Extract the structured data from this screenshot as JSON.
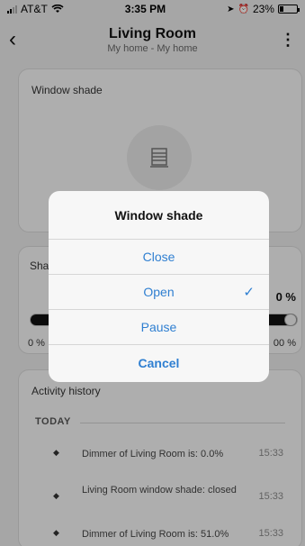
{
  "status_bar": {
    "carrier": "AT&T",
    "time": "3:35 PM",
    "battery": "23%",
    "battery_level": 0.23
  },
  "header": {
    "title": "Living Room",
    "subtitle": "My home - My home"
  },
  "window_card": {
    "title": "Window shade"
  },
  "shade_card": {
    "title_visible": "Sha",
    "value_partial": "0 %",
    "min_label": "0 %",
    "max_label": "00 %",
    "slider_level": 1.0
  },
  "activity": {
    "title": "Activity history",
    "section": "TODAY",
    "items": [
      {
        "text": "Dimmer of Living Room is: 0.0%",
        "time": "15:33"
      },
      {
        "text": "Living Room window shade: closed",
        "time": "15:33"
      },
      {
        "text": "Dimmer of Living Room is: 51.0%",
        "time": "15:33"
      }
    ]
  },
  "dialog": {
    "title": "Window shade",
    "options": [
      {
        "label": "Close",
        "selected": false
      },
      {
        "label": "Open",
        "selected": true
      },
      {
        "label": "Pause",
        "selected": false
      }
    ],
    "cancel_label": "Cancel",
    "accent": "#2f7fd1"
  },
  "icons": [
    "back-icon",
    "more-icon",
    "window-shade-icon",
    "check-icon",
    "wifi-icon",
    "location-icon",
    "alarm-icon"
  ]
}
